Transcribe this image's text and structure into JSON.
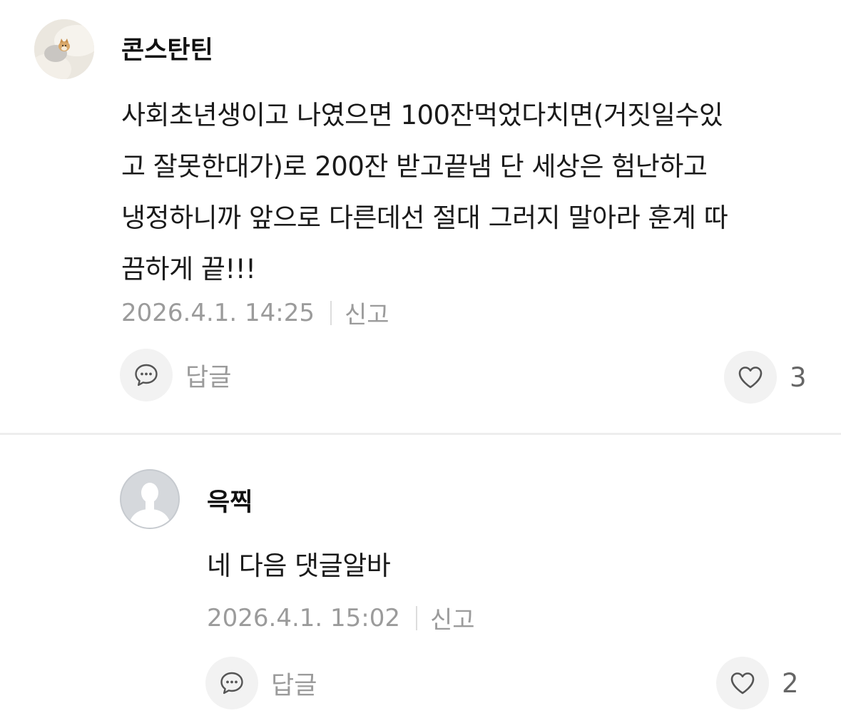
{
  "comments": [
    {
      "username": "콘스탄틴",
      "avatar_type": "photo",
      "body_lines": [
        "사회초년생이고 나였으면 100잔먹었다치면(거짓일수있",
        "고 잘못한대가)로 200잔 받고끝냄 단 세상은 험난하고",
        "냉정하니까 앞으로 다른데선 절대 그러지 말아라 훈계 따",
        "끔하게 끝!!!"
      ],
      "timestamp": "2026.4.1. 14:25",
      "report_label": "신고",
      "reply_label": "답글",
      "like_count": "3"
    },
    {
      "username": "윽찍",
      "avatar_type": "default-silhouette",
      "body_lines": [
        "네 다음 댓글알바"
      ],
      "timestamp": "2026.4.1. 15:02",
      "report_label": "신고",
      "reply_label": "답글",
      "like_count": "2"
    }
  ],
  "icons": {
    "reply": "speech-bubble-icon",
    "like": "heart-outline-icon",
    "default_avatar": "user-silhouette-icon"
  },
  "colors": {
    "meta_text": "#9b9b9b",
    "button_bg": "#f2f2f2",
    "divider": "#ededed",
    "avatar_default": "#d5d8dc"
  }
}
